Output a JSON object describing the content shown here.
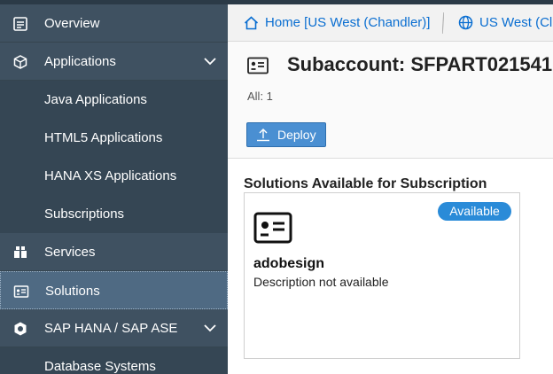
{
  "sidebar": {
    "items": [
      {
        "label": "Overview",
        "icon": "overview-icon"
      },
      {
        "label": "Applications",
        "icon": "applications-icon",
        "expanded": true,
        "children": [
          "Java Applications",
          "HTML5 Applications",
          "HANA XS Applications",
          "Subscriptions"
        ]
      },
      {
        "label": "Services",
        "icon": "services-icon"
      },
      {
        "label": "Solutions",
        "icon": "solutions-icon",
        "selected": true
      },
      {
        "label": "SAP HANA / SAP ASE",
        "icon": "database-icon",
        "expanded": true,
        "children": [
          "Database Systems"
        ]
      }
    ]
  },
  "breadcrumb": {
    "home": "Home [US West (Chandler)]",
    "region": "US West (Cl"
  },
  "header": {
    "title": "Subaccount: SFPART021541",
    "count": "All: 1",
    "deploy_label": "Deploy"
  },
  "content": {
    "section_title": "Solutions Available for Subscription",
    "tile": {
      "badge": "Available",
      "name": "adobesign",
      "description": "Description not available"
    }
  },
  "colors": {
    "sidebar_bg": "#3f5161",
    "accent": "#0a6ed1",
    "badge": "#2a8bd8",
    "deploy_button": "#4a8fd2"
  }
}
